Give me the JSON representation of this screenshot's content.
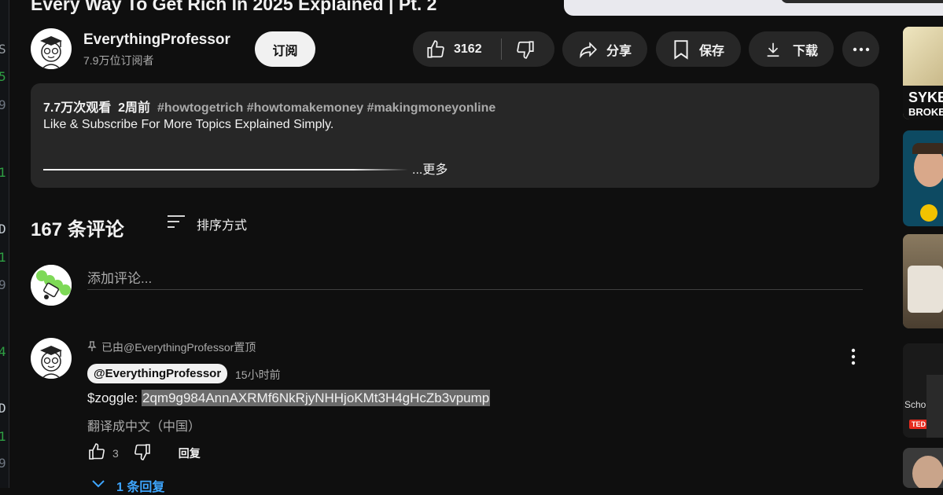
{
  "video": {
    "title": "Every Way To Get Rich In 2025 Explained | Pt. 2"
  },
  "channel": {
    "name": "EverythingProfessor",
    "subscribers": "7.9万位订阅者",
    "subscribe_label": "订阅"
  },
  "actions": {
    "likes": "3162",
    "share_label": "分享",
    "save_label": "保存",
    "download_label": "下载"
  },
  "description": {
    "views": "7.7万次观看",
    "age": "2周前",
    "hashtags": "#howtogetrich #howtomakemoney #makingmoneyonline",
    "text": "Like & Subscribe For More Topics Explained Simply.",
    "more_label": "...更多"
  },
  "comments": {
    "count_label": "167 条评论",
    "sort_label": "排序方式",
    "add_placeholder": "添加评论...",
    "pinned": {
      "pinned_by": "已由@EverythingProfessor置顶",
      "author": "@EverythingProfessor",
      "time": "15小时前",
      "text_prefix": "$zoggle: ",
      "text_highlight": "2qm9g984AnnAXRMf6NkRjyNHHjoKMt3H4gHcZb3vpump",
      "translate_label": "翻译成中文（中国）",
      "likes": "3",
      "reply_label": "回复",
      "replies_label": "1 条回复"
    }
  },
  "sidebar_thumbs": [
    {
      "text": "SYKE",
      "subtext": "BROKE"
    },
    {
      "text": ""
    },
    {
      "text": ""
    },
    {
      "text": "Scho",
      "badge": "TED"
    },
    {
      "text": ""
    }
  ],
  "left_strip_glyphs": [
    "S",
    "5",
    "9",
    "1",
    "D",
    "1",
    "9",
    "4",
    "D",
    "1",
    "9"
  ],
  "colors": {
    "background": "#0f0f0f",
    "pill": "#272727",
    "link": "#3ea6ff",
    "text_secondary": "#aaaaaa"
  }
}
